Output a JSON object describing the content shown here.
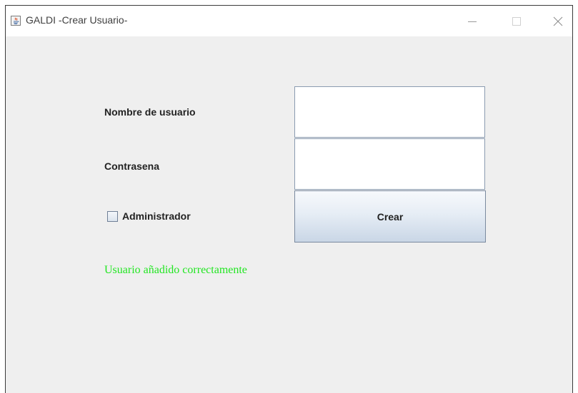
{
  "window": {
    "title": "GALDI -Crear Usuario-",
    "controls": {
      "minimize": "minimize-icon",
      "maximize": "maximize-icon",
      "close": "close-icon"
    }
  },
  "form": {
    "username_label": "Nombre de usuario",
    "username_value": "",
    "password_label": "Contrasena",
    "password_value": "",
    "admin_checkbox_label": "Administrador",
    "admin_checked": false,
    "create_button_label": "Crear"
  },
  "status": {
    "message": "Usuario añadido correctamente",
    "color": "#22e622"
  },
  "colors": {
    "background": "#efefef",
    "titlebar": "#ffffff",
    "button_gradient_top": "#f7f9fc",
    "button_gradient_bottom": "#c9d6e6"
  }
}
